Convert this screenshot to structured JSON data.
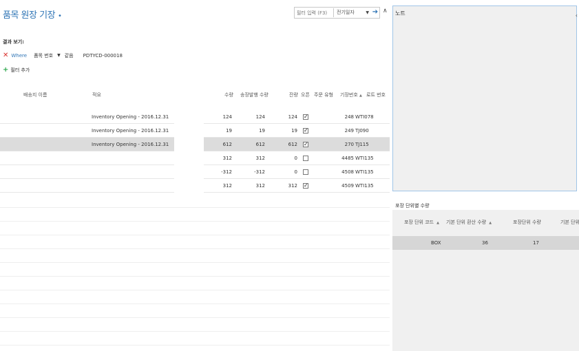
{
  "page": {
    "title": "품목 원장 기장",
    "title_dot": "•"
  },
  "filter": {
    "placeholder": "필터 입력 (F3)",
    "selected": "전기일자",
    "go_icon": "arrow-right-icon",
    "collapse_icon": "chevron-up-icon"
  },
  "result": {
    "label": "결과 보기:",
    "where_keyword": "Where",
    "field": "품목 번호",
    "operator": "같음",
    "value": "PDTYCD-000018",
    "add_filter": "필터 추가"
  },
  "table": {
    "headers": {
      "ship_name": "배송지 이름",
      "desc": "적요",
      "qty": "수량",
      "invoiced": "송장발행 수량",
      "remaining": "잔량",
      "open": "오픈",
      "order_type": "주문 유형",
      "entry_no": "기장번호",
      "lot_no": "로트 번호"
    },
    "rows": [
      {
        "desc": "Inventory Opening - 2016.12.31",
        "qty": "124",
        "invoiced": "124",
        "remaining": "124",
        "open": true,
        "entry_no": "248",
        "lot_no": "WTI078"
      },
      {
        "desc": "Inventory Opening - 2016.12.31",
        "qty": "19",
        "invoiced": "19",
        "remaining": "19",
        "open": true,
        "entry_no": "249",
        "lot_no": "TJ090"
      },
      {
        "desc": "Inventory Opening - 2016.12.31",
        "qty": "612",
        "invoiced": "612",
        "remaining": "612",
        "open": true,
        "entry_no": "270",
        "lot_no": "TJ115"
      },
      {
        "desc": "",
        "qty": "312",
        "invoiced": "312",
        "remaining": "0",
        "open": false,
        "entry_no": "4485",
        "lot_no": "WTI135"
      },
      {
        "desc": "",
        "qty": "-312",
        "invoiced": "-312",
        "remaining": "0",
        "open": false,
        "entry_no": "4508",
        "lot_no": "WTI135"
      },
      {
        "desc": "",
        "qty": "312",
        "invoiced": "312",
        "remaining": "312",
        "open": true,
        "entry_no": "4509",
        "lot_no": "WTI135"
      }
    ]
  },
  "notes": {
    "label": "노트",
    "right_glyph": "‹"
  },
  "packaging": {
    "title": "포장 단위별 수량",
    "headers": {
      "code": "포장 단위 코드",
      "base_conv": "기본 단위 환산 수량",
      "pack_qty": "포장단위 수량",
      "base_qty": "기본 단위"
    },
    "rows": [
      {
        "code": "BOX",
        "base_conv": "36",
        "pack_qty": "17"
      }
    ]
  },
  "colors": {
    "accent": "#2e74b5",
    "remove": "#d9302c",
    "add": "#2fa84f"
  }
}
